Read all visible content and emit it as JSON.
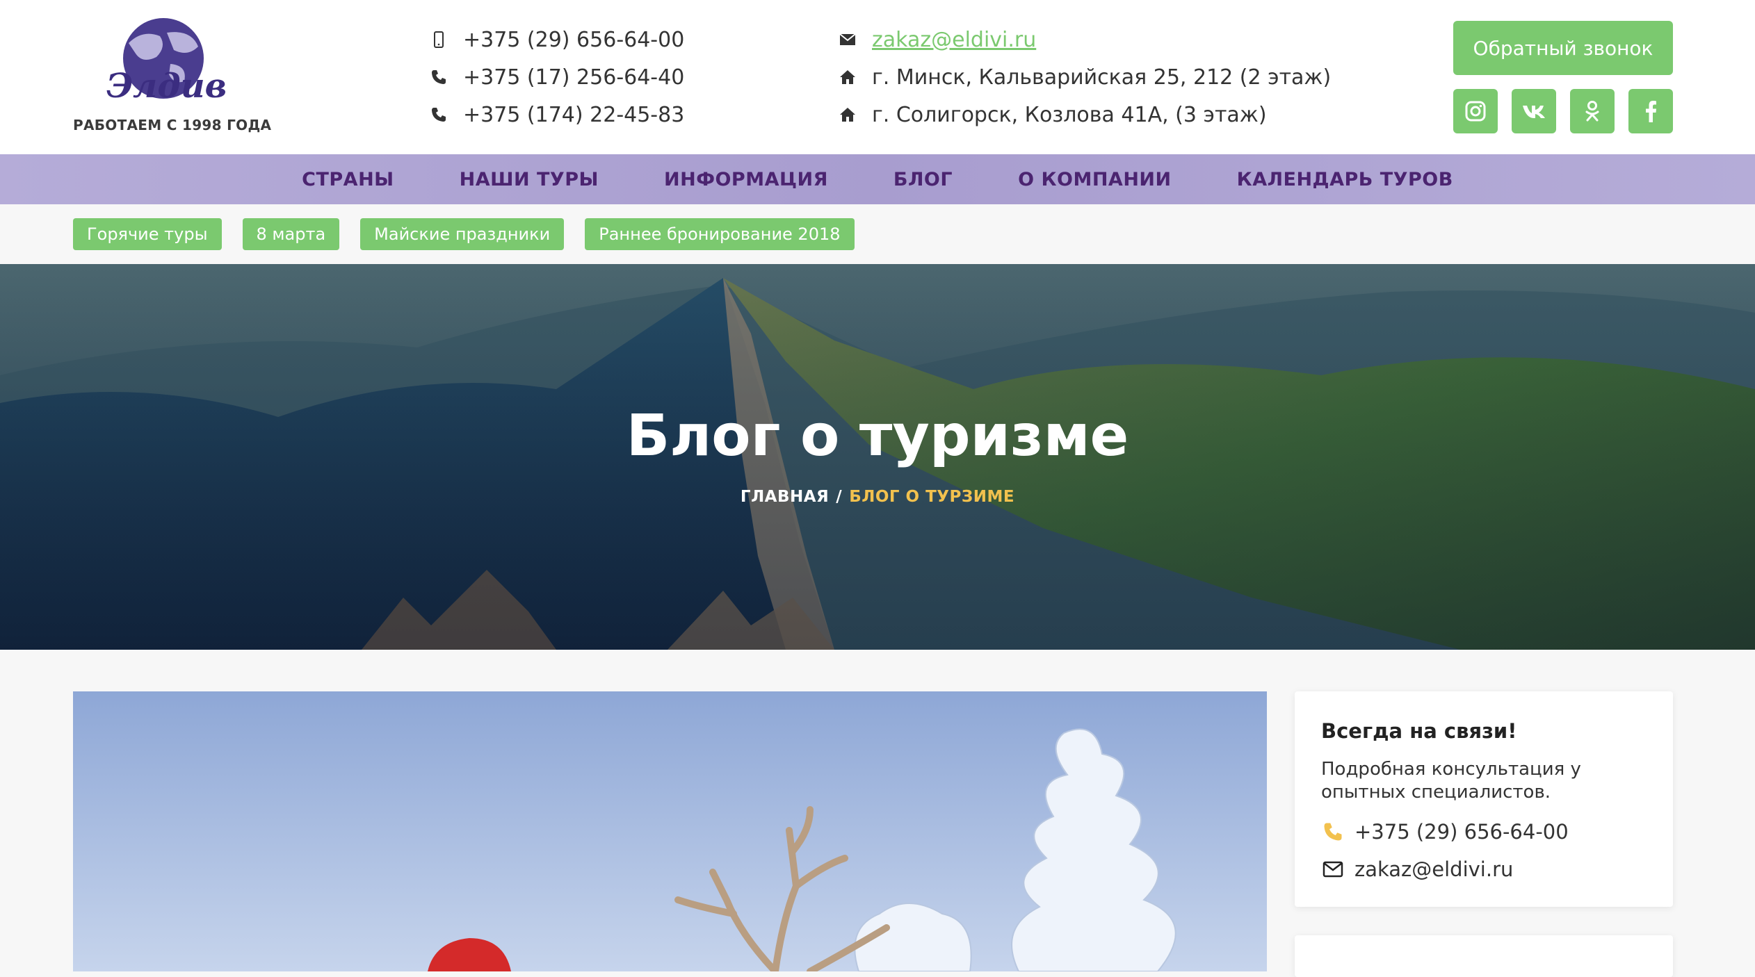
{
  "header": {
    "logo_tagline": "РАБОТАЕМ С 1998 ГОДА",
    "phones": [
      {
        "icon": "mobile-phone-icon",
        "text": "+375 (29) 656-64-00"
      },
      {
        "icon": "phone-icon",
        "text": "+375 (17) 256-64-40"
      },
      {
        "icon": "phone-icon",
        "text": "+375 (174) 22-45-83"
      }
    ],
    "email": "zakaz@eldivi.ru",
    "addresses": [
      "г. Минск, Кальварийская 25, 212 (2 этаж)",
      "г. Солигорск, Козлова 41А, (3 этаж)"
    ],
    "callback_label": "Обратный звонок",
    "socials": [
      "instagram-icon",
      "vk-icon",
      "odnoklassniki-icon",
      "facebook-icon"
    ]
  },
  "nav": {
    "items": [
      "СТРАНЫ",
      "НАШИ ТУРЫ",
      "ИНФОРМАЦИЯ",
      "БЛОГ",
      "О КОМПАНИИ",
      "КАЛЕНДАРЬ ТУРОВ"
    ]
  },
  "tags": [
    "Горячие туры",
    "8 марта",
    "Майские праздники",
    "Раннее бронирование 2018"
  ],
  "hero": {
    "title": "Блог о туризме",
    "breadcrumb_home": "ГЛАВНАЯ",
    "breadcrumb_sep": "/",
    "breadcrumb_current": "БЛОГ О ТУРЗИМЕ"
  },
  "sidebar": {
    "title": "Всегда на связи!",
    "text": "Подробная консультация у опытных специалистов.",
    "phone": "+375 (29) 656-64-00",
    "email": "zakaz@eldivi.ru"
  },
  "colors": {
    "accent_green": "#7bc96f",
    "nav_purple": "#a89dcf",
    "nav_text": "#4b2470",
    "breadcrumb_current": "#f2c14e"
  }
}
